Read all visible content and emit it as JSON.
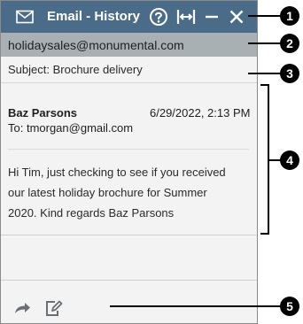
{
  "window": {
    "title": "Email - History",
    "icons": {
      "envelope": "envelope-icon",
      "help": "help-icon",
      "expand": "expand-width-icon",
      "minimize": "minimize-icon",
      "close": "close-icon"
    }
  },
  "email": {
    "from": "holidaysales@monumental.com",
    "subject": "Subject: Brochure delivery",
    "sender": "Baz Parsons",
    "date": "6/29/2022, 2:13 PM",
    "to": "To: tmorgan@gmail.com",
    "body_lines": [
      "Hi Tim, just checking to see if you received",
      "our latest holiday brochure for  Summer",
      "2020. Kind regards Baz Parsons"
    ]
  },
  "footer": {
    "icons": {
      "forward": "forward-icon",
      "edit": "edit-note-icon"
    }
  },
  "callouts": [
    "1",
    "2",
    "3",
    "4",
    "5"
  ],
  "colors": {
    "titlebar": "#4a6c89",
    "from_bar": "#a9b0b3",
    "panel": "#f3f3f3",
    "callout": "#000000"
  }
}
